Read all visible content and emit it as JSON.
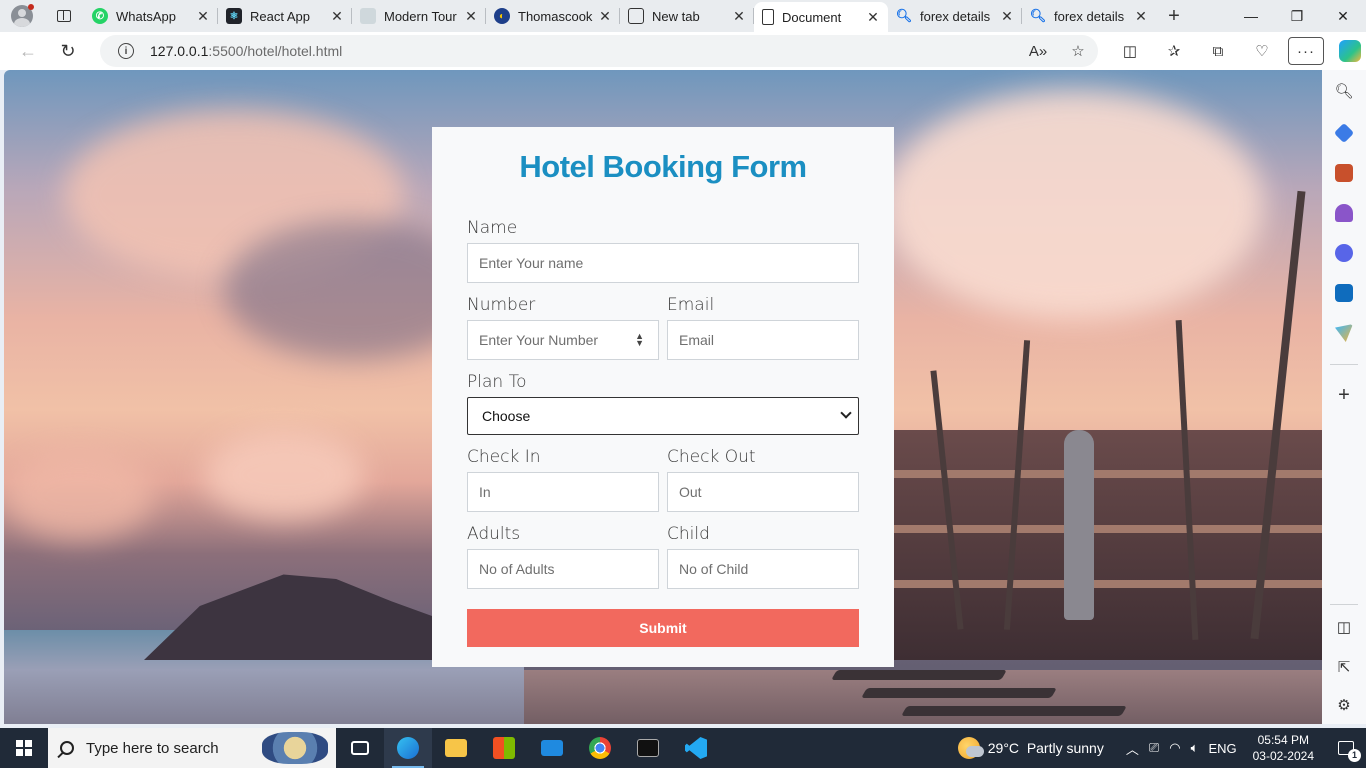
{
  "browser": {
    "tabs": [
      {
        "title": "WhatsApp",
        "icon": "whatsapp-icon",
        "color": "#25d366"
      },
      {
        "title": "React App",
        "icon": "react-icon",
        "color": "#20232a"
      },
      {
        "title": "Modern Tour",
        "icon": "page-thumbnail-icon",
        "color": "#cfd8dc"
      },
      {
        "title": "Thomascook",
        "icon": "thomascook-icon",
        "color": "#1e3f8a"
      },
      {
        "title": "New tab",
        "icon": "new-tab-icon",
        "color": "#ffffff"
      },
      {
        "title": "Document",
        "icon": "document-icon",
        "color": "#ffffff",
        "active": true
      },
      {
        "title": "forex details",
        "icon": "search-icon",
        "color": "#ffffff"
      },
      {
        "title": "forex details",
        "icon": "search-icon",
        "color": "#ffffff"
      }
    ],
    "url_host": "127.0.0.1",
    "url_rest": ":5500/hotel/hotel.html"
  },
  "form": {
    "title": "Hotel Booking Form",
    "name_label": "Name",
    "name_placeholder": "Enter Your name",
    "number_label": "Number",
    "number_placeholder": "Enter Your Number",
    "email_label": "Email",
    "email_placeholder": "Email",
    "plan_label": "Plan To",
    "plan_selected": "Choose",
    "checkin_label": "Check In",
    "checkin_placeholder": "In",
    "checkout_label": "Check Out",
    "checkout_placeholder": "Out",
    "adults_label": "Adults",
    "adults_placeholder": "No of Adults",
    "child_label": "Child",
    "child_placeholder": "No of Child",
    "submit_label": "Submit"
  },
  "taskbar": {
    "search_placeholder": "Type here to search",
    "temperature": "29°C",
    "weather": "Partly sunny",
    "language": "ENG",
    "time": "05:54 PM",
    "date": "03-02-2024",
    "notification_count": "1"
  },
  "colors": {
    "title_blue": "#1b8fc2",
    "submit_coral": "#f2695e"
  }
}
